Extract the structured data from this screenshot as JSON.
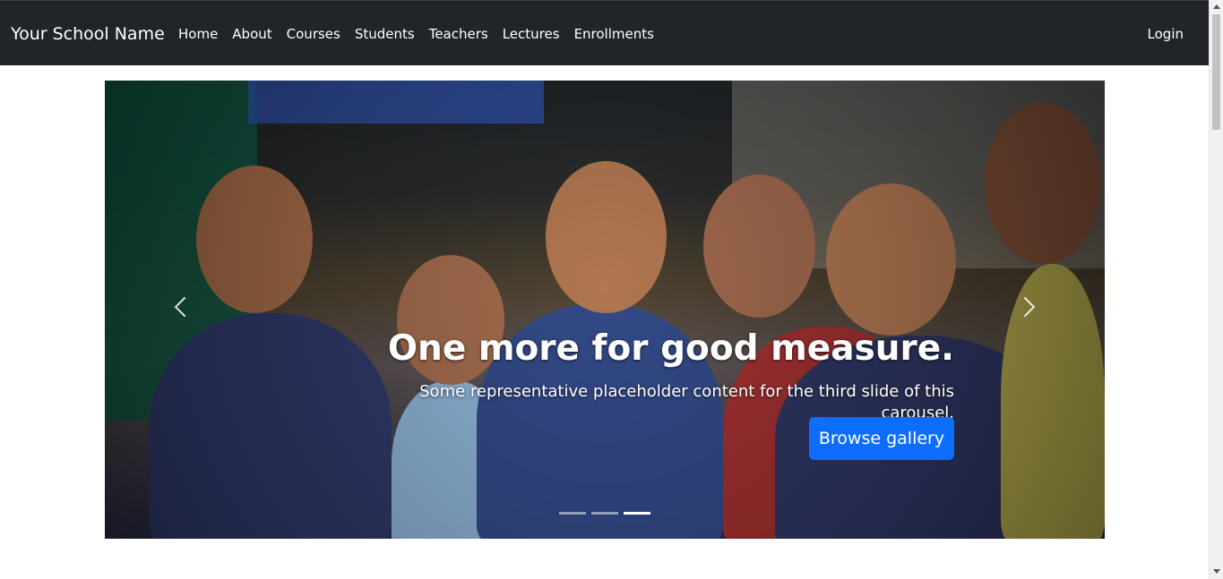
{
  "navbar": {
    "brand": "Your School Name",
    "items": [
      {
        "label": "Home"
      },
      {
        "label": "About"
      },
      {
        "label": "Courses"
      },
      {
        "label": "Students"
      },
      {
        "label": "Teachers"
      },
      {
        "label": "Lectures"
      },
      {
        "label": "Enrollments"
      }
    ],
    "login": "Login",
    "background": "#212529"
  },
  "carousel": {
    "title": "One more for good measure.",
    "text": "Some representative placeholder content for the third slide of this carousel.",
    "button": "Browse gallery",
    "active_indicator": 3,
    "indicator_count": 3,
    "button_color": "#0d6efd"
  }
}
